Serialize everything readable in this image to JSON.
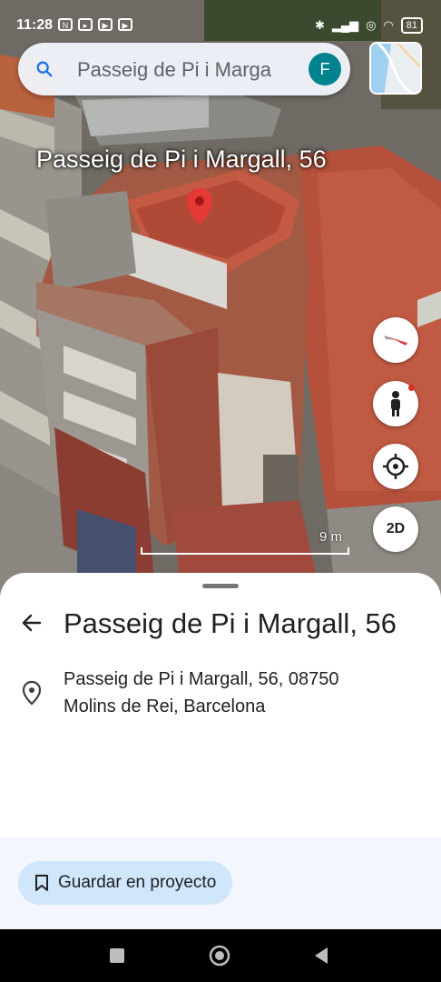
{
  "status_bar": {
    "time": "11:28",
    "battery": "81"
  },
  "search": {
    "placeholder": "Passeig de Pi i Marga",
    "avatar_initial": "F"
  },
  "map": {
    "place_label": "Passeig de Pi i Margall, 56",
    "scale_label": "9 m",
    "view_toggle": "2D"
  },
  "place": {
    "title": "Passeig de Pi i Margall, 56",
    "address_line1": "Passeig de Pi i Margall, 56, 08750",
    "address_line2": "Molins de Rei, Barcelona"
  },
  "actions": {
    "save_label": "Guardar en proyecto"
  },
  "icons": {
    "search": "search-icon",
    "back": "arrow-left-icon",
    "address": "location-pin-icon",
    "save": "bookmark-icon",
    "compass": "compass-icon",
    "street_view": "pegman-icon",
    "my_location": "crosshair-icon"
  },
  "colors": {
    "pin": "#e53935",
    "avatar": "#00838f",
    "save_button": "#cfe6fb"
  }
}
